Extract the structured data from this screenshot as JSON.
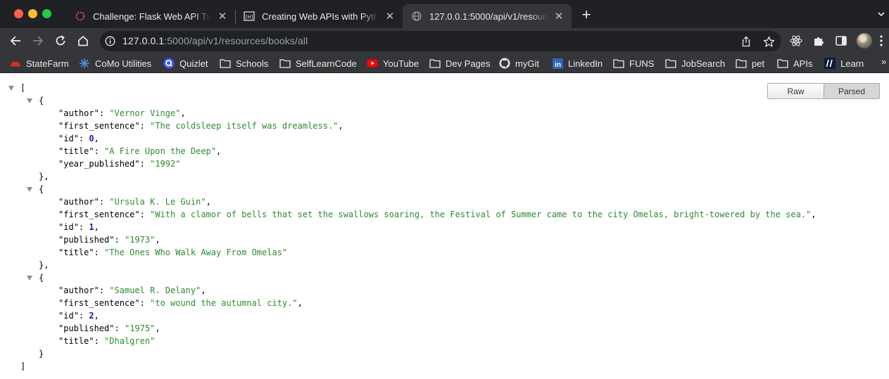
{
  "tabs": [
    {
      "title": "Challenge: Flask Web API Tutorial",
      "favicon": "spinner-icon",
      "color": "#f0634a"
    },
    {
      "title": "Creating Web APIs with Python and Flask",
      "favicon": "programming-historian-icon"
    },
    {
      "title": "127.0.0.1:5000/api/v1/resources/books/all",
      "favicon": "globe-icon",
      "active": true
    }
  ],
  "toolbar": {
    "url_host": "127.0.0.1",
    "url_rest": ":5000/api/v1/resources/books/all"
  },
  "bookmarks": [
    {
      "label": "StateFarm",
      "icon": "statefarm-icon"
    },
    {
      "label": "CoMo Utilities",
      "icon": "como-utilities-icon"
    },
    {
      "label": "Quizlet",
      "icon": "quizlet-icon"
    },
    {
      "label": "Schools",
      "icon": "folder-icon"
    },
    {
      "label": "SelfLearnCode",
      "icon": "folder-icon"
    },
    {
      "label": "YouTube",
      "icon": "youtube-icon"
    },
    {
      "label": "Dev Pages",
      "icon": "folder-icon"
    },
    {
      "label": "myGit",
      "icon": "github-icon"
    },
    {
      "label": "LinkedIn",
      "icon": "linkedin-icon"
    },
    {
      "label": "FUNS",
      "icon": "folder-icon"
    },
    {
      "label": "JobSearch",
      "icon": "folder-icon"
    },
    {
      "label": "pet",
      "icon": "folder-icon"
    },
    {
      "label": "APIs",
      "icon": "folder-icon"
    },
    {
      "label": "Learn",
      "icon": "learn-icon"
    }
  ],
  "bookmarks_more": "»",
  "viewer": {
    "raw_label": "Raw",
    "parsed_label": "Parsed",
    "active": "Parsed"
  },
  "books": [
    {
      "entries": [
        {
          "key": "author",
          "value": "Vernor Vinge",
          "type": "string"
        },
        {
          "key": "first_sentence",
          "value": "The coldsleep itself was dreamless.",
          "type": "string"
        },
        {
          "key": "id",
          "value": "0",
          "type": "number"
        },
        {
          "key": "title",
          "value": "A Fire Upon the Deep",
          "type": "string"
        },
        {
          "key": "year_published",
          "value": "1992",
          "type": "string"
        }
      ]
    },
    {
      "entries": [
        {
          "key": "author",
          "value": "Ursula K. Le Guin",
          "type": "string"
        },
        {
          "key": "first_sentence",
          "value": "With a clamor of bells that set the swallows soaring, the Festival of Summer came to the city Omelas, bright-towered by the sea.",
          "type": "string"
        },
        {
          "key": "id",
          "value": "1",
          "type": "number"
        },
        {
          "key": "published",
          "value": "1973",
          "type": "string"
        },
        {
          "key": "title",
          "value": "The Ones Who Walk Away From Omelas",
          "type": "string"
        }
      ]
    },
    {
      "entries": [
        {
          "key": "author",
          "value": "Samuel R. Delany",
          "type": "string"
        },
        {
          "key": "first_sentence",
          "value": "to wound the autumnal city.",
          "type": "string"
        },
        {
          "key": "id",
          "value": "2",
          "type": "number"
        },
        {
          "key": "published",
          "value": "1975",
          "type": "string"
        },
        {
          "key": "title",
          "value": "Dhalgren",
          "type": "string"
        }
      ]
    }
  ],
  "colors": {
    "string": "#2e8b2e",
    "number": "#1a1aa6",
    "chrome_dark": "#202124",
    "chrome_toolbar": "#35363a"
  }
}
